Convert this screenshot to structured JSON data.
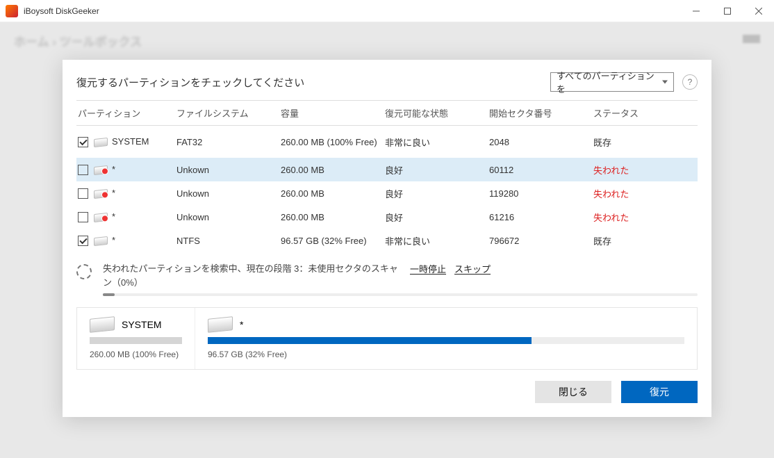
{
  "window": {
    "title": "iBoysoft DiskGeeker"
  },
  "breadcrumb": "ホーム › ツールボックス",
  "panel": {
    "title": "復元するパーティションをチェックしてください",
    "filter": "すべてのパーティションを",
    "help": "?"
  },
  "columns": {
    "partition": "パーティション",
    "fs": "ファイルシステム",
    "cap": "容量",
    "state": "復元可能な状態",
    "sector": "開始セクタ番号",
    "status": "ステータス"
  },
  "rows": [
    {
      "checked": true,
      "lost": false,
      "name": "SYSTEM",
      "fs": "FAT32",
      "cap": "260.00 MB (100% Free)",
      "state": "非常に良い",
      "sector": "2048",
      "status": "既存",
      "tall": true
    },
    {
      "checked": false,
      "lost": true,
      "name": "*",
      "fs": "Unkown",
      "cap": "260.00 MB",
      "state": "良好",
      "sector": "60112",
      "status": "失われた",
      "selected": true
    },
    {
      "checked": false,
      "lost": true,
      "name": "*",
      "fs": "Unkown",
      "cap": "260.00 MB",
      "state": "良好",
      "sector": "119280",
      "status": "失われた"
    },
    {
      "checked": false,
      "lost": true,
      "name": "*",
      "fs": "Unkown",
      "cap": "260.00 MB",
      "state": "良好",
      "sector": "61216",
      "status": "失われた"
    },
    {
      "checked": true,
      "lost": false,
      "name": "*",
      "fs": "NTFS",
      "cap": "96.57 GB (32% Free)",
      "state": "非常に良い",
      "sector": "796672",
      "status": "既存"
    }
  ],
  "scan": {
    "msg": "失われたパーティションを検索中、現在の段階 3：未使用セクタのスキャン（0%）",
    "pause": "一時停止",
    "skip": "スキップ"
  },
  "cards": {
    "system": {
      "name": "SYSTEM",
      "sub": "260.00 MB (100% Free)"
    },
    "main": {
      "name": "*",
      "sub": "96.57 GB (32% Free)",
      "fill_pct": 68
    }
  },
  "buttons": {
    "close": "閉じる",
    "restore": "復元"
  }
}
